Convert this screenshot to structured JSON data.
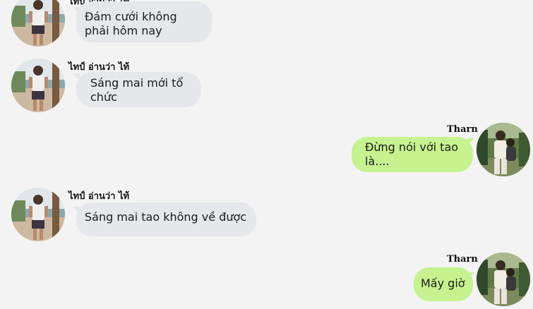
{
  "conversation": {
    "messages": [
      {
        "side": "left",
        "sender": "ไทป์ อ่านว่า ไท้",
        "text": "Đám cưới không phải hôm nay",
        "avatar": "profile-photo-male-beach"
      },
      {
        "side": "left",
        "sender": "ไทป์ อ่านว่า ไท้",
        "text": "Sáng mai mới tổ chức",
        "avatar": "profile-photo-male-beach"
      },
      {
        "side": "right",
        "sender": "Tharn",
        "text": "Đừng nói với tao là....",
        "avatar": "profile-photo-couple-garden"
      },
      {
        "side": "left",
        "sender": "ไทป์ อ่านว่า ไท้",
        "text": "Sáng mai tao không về được",
        "avatar": "profile-photo-male-beach"
      },
      {
        "side": "right",
        "sender": "Tharn",
        "text": "Mấy giờ",
        "avatar": "profile-photo-couple-garden"
      }
    ]
  },
  "colors": {
    "background": "#f3f3f3",
    "left_bubble": "#e5e7ea",
    "right_bubble": "#c6f28f"
  }
}
